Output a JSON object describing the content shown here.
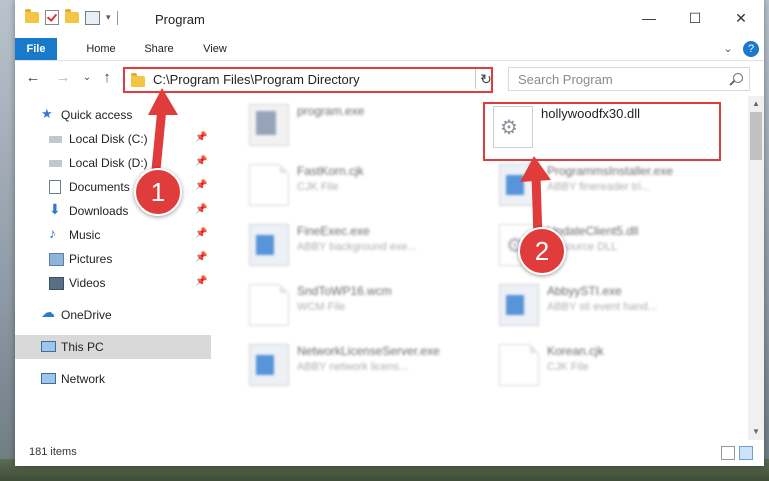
{
  "window": {
    "title": "Program",
    "min_label": "—",
    "max_label": "☐",
    "close_label": "✕"
  },
  "ribbon": {
    "tabs": [
      "File",
      "Home",
      "Share",
      "View"
    ],
    "expand_label": "⌄",
    "help_label": "?"
  },
  "address": {
    "path": "C:\\Program Files\\Program Directory",
    "chevron": "⌄",
    "refresh": "↻"
  },
  "nav": {
    "back": "←",
    "forward": "→",
    "recent": "⌄",
    "up": "↑"
  },
  "search": {
    "placeholder": "Search Program"
  },
  "sidebar": {
    "items": [
      {
        "label": "Quick access"
      },
      {
        "label": "Local Disk (C:)"
      },
      {
        "label": "Local Disk (D:)"
      },
      {
        "label": "Documents"
      },
      {
        "label": "Downloads"
      },
      {
        "label": "Music"
      },
      {
        "label": "Pictures"
      },
      {
        "label": "Videos"
      },
      {
        "label": "OneDrive"
      },
      {
        "label": "This PC"
      },
      {
        "label": "Network"
      }
    ]
  },
  "files": [
    {
      "name": "program.exe",
      "desc": ""
    },
    {
      "name": "hollywoodfx30.dll",
      "desc": ""
    },
    {
      "name": "FastKorn.cjk",
      "desc": "CJK File"
    },
    {
      "name": "ProgrammsInstaller.exe",
      "desc": "ABBY finereader tri..."
    },
    {
      "name": "FineExec.exe",
      "desc": "ABBY background exe..."
    },
    {
      "name": "UpdateClient5.dll",
      "desc": "Resource DLL"
    },
    {
      "name": "SndToWP16.wcm",
      "desc": "WCM File"
    },
    {
      "name": "AbbyySTI.exe",
      "desc": "ABBY sti event hand..."
    },
    {
      "name": "NetworkLicenseServer.exe",
      "desc": "ABBY network licens..."
    },
    {
      "name": "Korean.cjk",
      "desc": "CJK File"
    }
  ],
  "status": {
    "count": "181 items"
  },
  "callouts": [
    {
      "label": "1"
    },
    {
      "label": "2"
    }
  ],
  "colors": {
    "accent": "#1979ca",
    "highlight": "#e03c3c"
  }
}
